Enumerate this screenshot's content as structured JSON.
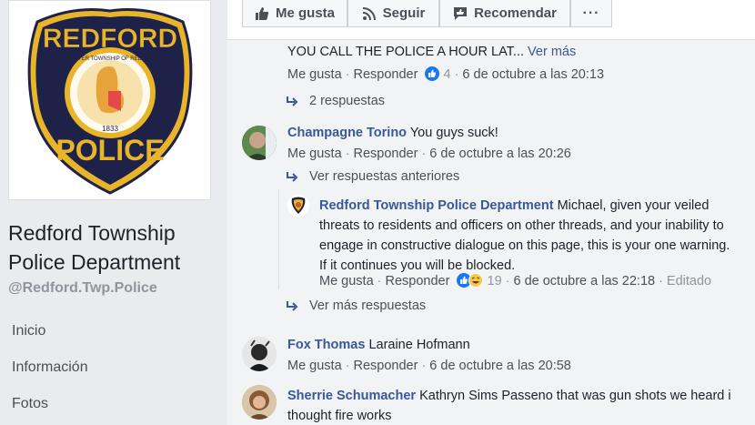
{
  "sidebar": {
    "page_name": "Redford Township Police Department",
    "handle": "@Redford.Twp.Police",
    "logo": {
      "top_text": "REDFORD",
      "bottom_text": "POLICE",
      "ring_text": "CHARTER TOWNSHIP OF REDFORD",
      "year": "1833"
    },
    "nav": [
      "Inicio",
      "Información",
      "Fotos"
    ]
  },
  "action_bar": {
    "like": "Me gusta",
    "follow": "Seguir",
    "recommend": "Recomendar",
    "more": "···"
  },
  "comments": {
    "c0": {
      "text": "YOU CALL THE POLICE A HOUR LAT...",
      "see_more": "Ver más",
      "like": "Me gusta",
      "reply": "Responder",
      "reactions": "4",
      "time": "6 de octubre a las 20:13",
      "replies_link": "2 respuestas"
    },
    "c1": {
      "author": "Champagne Torino",
      "text": "You guys suck!",
      "like": "Me gusta",
      "reply": "Responder",
      "time": "6 de octubre a las 20:26",
      "prev_replies": "Ver respuestas anteriores",
      "more_replies": "Ver más respuestas"
    },
    "r1": {
      "author": "Redford Township Police Department",
      "lines": [
        "Michael, given your veiled",
        "threats to residents and officers on other threads, and your inability to",
        "engage in constructive dialogue on this page, this is your one warning.",
        "If it continues you will be blocked."
      ],
      "like": "Me gusta",
      "reply": "Responder",
      "reactions": "19",
      "time": "6 de octubre a las 22:18",
      "edited": "Editado"
    },
    "c2": {
      "author": "Fox Thomas",
      "text": "Laraine Hofmann",
      "like": "Me gusta",
      "reply": "Responder",
      "time": "6 de octubre a las 20:58"
    },
    "c3": {
      "author": "Sherrie Schumacher",
      "lines": [
        "Kathryn Sims Passeno that was gun shots we heard i",
        "thought fire works"
      ]
    }
  },
  "colors": {
    "link_blue": "#385898",
    "badge_navy": "#1f2248",
    "badge_gold": "#e8b52a",
    "like_blue": "#1877f2",
    "haha_yellow": "#f7c844"
  }
}
